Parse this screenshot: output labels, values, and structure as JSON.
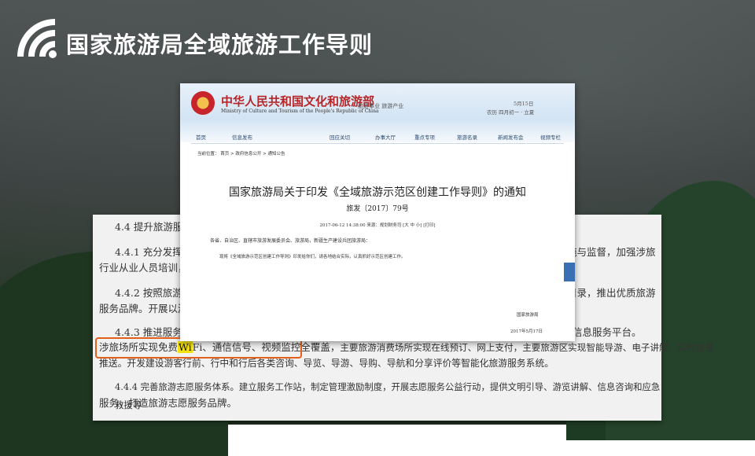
{
  "slide": {
    "title": "国家旅游局全域旅游工作导则"
  },
  "back_document": {
    "line1": "4.4 提升旅游服务",
    "line2": "4.4.1 充分发挥标准",
    "line2_right": "施与监督，加强涉旅",
    "line3": "行业从业人员培训，提",
    "line4": "4.4.2 按照旅游需求",
    "line4_right": "目录，推出优质旅游",
    "line5": "服务品牌。开展以游客",
    "line6_left": "4.4.3 推进服务智能",
    "line6_right": "综合信息服务平台。",
    "line7_a": "涉旅场所实现免费",
    "line7_wi": "Wi",
    "line7_b": "Fi、通信信号、视频监控全覆盖，",
    "line7_c": "主要旅游消费场所实现在线预订、网上支付，主要旅游区实现智能导游、电子讲解、实时信息",
    "line8": "推送。开发建设游客行前、行中和行后各类咨询、导览、导游、导购、导航和分享评价等智能化旅游服务系统。",
    "line9": "4.4.4 完善旅游志愿服务体系。建立服务工作站，制定管理激励制度，开展志愿服务公益行动，提供文明引导、游览讲解、信息咨询和应急救援等",
    "line10": "服务，打造旅游志愿服务品牌。"
  },
  "front_document": {
    "ministry_cn": "中华人民共和国文化和旅游部",
    "ministry_en": "Ministry of Culture and Tourism of the People's Republic of China",
    "slogan": "旅游事业 旅游产业",
    "date_line1": "5月15日",
    "date_line2": "农历 四月初一 · 立夏",
    "nav_items": [
      "首页",
      "信息发布",
      "回应关切",
      "办事大厅",
      "重点专项",
      "旅游名录",
      "新闻发布会",
      "视频专栏"
    ],
    "breadcrumb": "当前位置： 首页 > 政府信息公开 > 通知公告",
    "notice_title": "国家旅游局关于印发《全域旅游示范区创建工作导则》的通知",
    "notice_number": "旅发〔2017〕79号",
    "meta": "2017-06-12 14:38:00    来源：规划财务司    [大 中 小]    [打印]",
    "addressee": "各省、自治区、直辖市旅游发展委员会、旅游局，新疆生产建设兵团旅游局：",
    "body": "现将《全域旅游示范区创建工作导则》印发给你们，请各地结合实际，认真抓好示范区创建工作。",
    "issuer": "国家旅游局",
    "issue_date": "2017年5月17日"
  },
  "colors": {
    "title_text": "#ffffff",
    "highlight_border": "#e2601b",
    "wi_highlight": "#f5e20d",
    "ministry_red": "#b52628"
  },
  "icons": {
    "logo": "wifi-arc-logo"
  }
}
